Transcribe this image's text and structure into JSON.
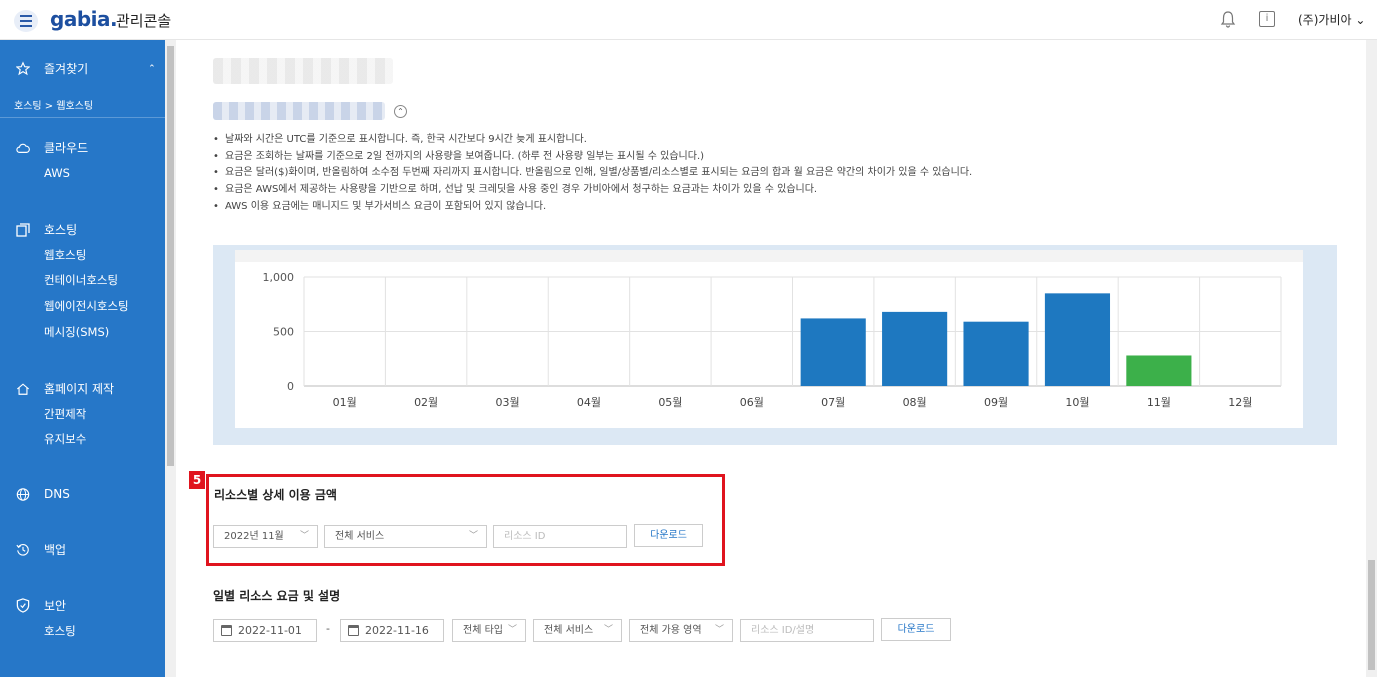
{
  "header": {
    "logo": "gabia.",
    "console_title": "관리콘솔",
    "user_name": "(주)가비아"
  },
  "sidebar": {
    "favorites": "즐겨찾기",
    "breadcrumb": "호스팅 > 웹호스팅",
    "cloud": "클라우드",
    "cloud_items": [
      "AWS"
    ],
    "hosting": "호스팅",
    "hosting_items": [
      "웹호스팅",
      "컨테이너호스팅",
      "웹에이전시호스팅",
      "메시징(SMS)"
    ],
    "homepage": "홈페이지 제작",
    "homepage_items": [
      "간편제작",
      "유지보수"
    ],
    "dns": "DNS",
    "backup": "백업",
    "security": "보안",
    "security_items": [
      "호스팅"
    ]
  },
  "notes": [
    "날짜와 시간은 UTC를 기준으로 표시합니다. 즉, 한국 시간보다 9시간 늦게 표시합니다.",
    "요금은 조회하는 날짜를 기준으로 2일 전까지의 사용량을 보여줍니다. (하루 전 사용량 일부는 표시될 수 있습니다.)",
    "요금은 달러($)화이며, 반올림하여 소수점 두번째 자리까지 표시합니다. 반올림으로 인해, 일별/상품별/리소스별로 표시되는 요금의 합과 월 요금은 약간의 차이가 있을 수 있습니다.",
    "요금은 AWS에서 제공하는 사용량을 기반으로 하며, 선납 및 크레딧을 사용 중인 경우 가비아에서 청구하는 요금과는 차이가 있을 수 있습니다.",
    "AWS 이용 요금에는 매니지드 및 부가서비스 요금이 포함되어 있지 않습니다."
  ],
  "chart_data": {
    "type": "bar",
    "categories": [
      "01월",
      "02월",
      "03월",
      "04월",
      "05월",
      "06월",
      "07월",
      "08월",
      "09월",
      "10월",
      "11월",
      "12월"
    ],
    "values": [
      0,
      0,
      0,
      0,
      0,
      0,
      620,
      680,
      590,
      850,
      280,
      0
    ],
    "colors": [
      "#1e78c0",
      "#1e78c0",
      "#1e78c0",
      "#1e78c0",
      "#1e78c0",
      "#1e78c0",
      "#1e78c0",
      "#1e78c0",
      "#1e78c0",
      "#1e78c0",
      "#3cb04a",
      "#1e78c0"
    ],
    "yticks": [
      "1,000",
      "500",
      "0"
    ],
    "ylim": [
      0,
      1000
    ]
  },
  "resource_section": {
    "badge": "5",
    "title": "리소스별 상세 이용 금액",
    "month_select": "2022년 11월",
    "service_select": "전체 서비스",
    "resource_placeholder": "리소스 ID",
    "download": "다운로드"
  },
  "daily_section": {
    "title": "일별 리소스 요금 및 설명",
    "start_date": "2022-11-01",
    "end_date": "2022-11-16",
    "type_select": "전체 타입",
    "service_select": "전체 서비스",
    "zone_select": "전체 가용 영역",
    "resource_placeholder": "리소스 ID/설명",
    "download": "다운로드"
  }
}
